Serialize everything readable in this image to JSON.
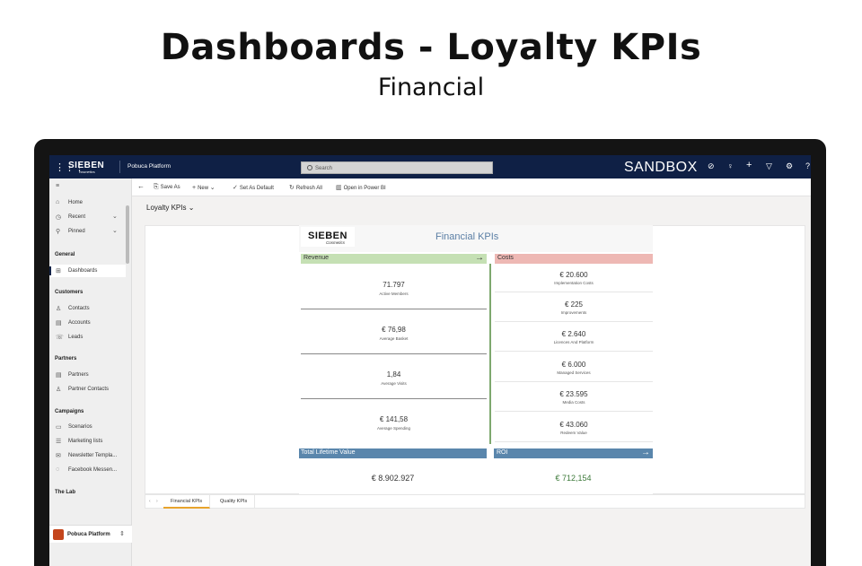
{
  "heading": "Dashboards - Loyalty KPIs",
  "subheading": "Financial",
  "topbar": {
    "brand": "SIEBEN",
    "brand_sub": "cosmetics",
    "platform": "Pobuca Platform",
    "search_placeholder": "Search",
    "environment": "SANDBOX"
  },
  "sidebar": {
    "top": [
      {
        "label": "Home",
        "icon": "home-icon"
      },
      {
        "label": "Recent",
        "icon": "clock-icon"
      },
      {
        "label": "Pinned",
        "icon": "pin-icon"
      }
    ],
    "sections": [
      {
        "title": "General",
        "items": [
          {
            "label": "Dashboards",
            "icon": "dashboard-icon",
            "active": true
          }
        ]
      },
      {
        "title": "Customers",
        "items": [
          {
            "label": "Contacts",
            "icon": "person-icon"
          },
          {
            "label": "Accounts",
            "icon": "building-icon"
          },
          {
            "label": "Leads",
            "icon": "phone-icon"
          }
        ]
      },
      {
        "title": "Partners",
        "items": [
          {
            "label": "Partners",
            "icon": "building-icon"
          },
          {
            "label": "Partner Contacts",
            "icon": "person-icon"
          }
        ]
      },
      {
        "title": "Campaigns",
        "items": [
          {
            "label": "Scenarios",
            "icon": "folder-icon"
          },
          {
            "label": "Marketing lists",
            "icon": "list-icon"
          },
          {
            "label": "Newsletter Templa...",
            "icon": "mail-icon"
          },
          {
            "label": "Facebook Messen...",
            "icon": "chat-icon"
          }
        ]
      },
      {
        "title": "The Lab",
        "items": []
      }
    ],
    "footer": "Pobuca Platform"
  },
  "commandbar": {
    "save_as": "Save As",
    "new": "New",
    "set_default": "Set As Default",
    "refresh": "Refresh All",
    "open_bi": "Open in Power BI"
  },
  "page_title": "Loyalty KPIs",
  "report": {
    "logo": "SIEBEN",
    "logo_sub": "Cosmetics",
    "title": "Financial KPIs",
    "revenue_label": "Revenue",
    "costs_label": "Costs",
    "revenue": [
      {
        "value": "71.797",
        "label": "Active Members"
      },
      {
        "value": "€ 76,98",
        "label": "Average Basket"
      },
      {
        "value": "1,84",
        "label": "Average Visits"
      },
      {
        "value": "€ 141,58",
        "label": "Average Spending"
      }
    ],
    "costs": [
      {
        "value": "€ 20.600",
        "label": "Implementation Costs"
      },
      {
        "value": "€ 225",
        "label": "Improvements"
      },
      {
        "value": "€ 2.640",
        "label": "Licences And Platform"
      },
      {
        "value": "€ 6.000",
        "label": "Managed Services"
      },
      {
        "value": "€ 23.595",
        "label": "Media Costs"
      },
      {
        "value": "€ 43.060",
        "label": "Redeem Value"
      }
    ],
    "ltv_label": "Total Lifetime Value",
    "ltv_value": "€ 8.902.927",
    "roi_label": "ROI",
    "roi_value": "€ 712,154"
  },
  "tabs": [
    {
      "label": "Financial KPIs",
      "active": true
    },
    {
      "label": "Quality KPIs",
      "active": false
    }
  ]
}
